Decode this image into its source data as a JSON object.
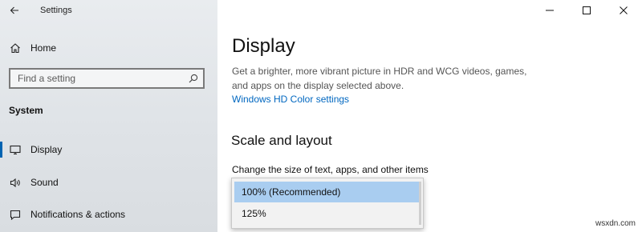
{
  "app": {
    "title": "Settings",
    "home_label": "Home"
  },
  "search": {
    "placeholder": "Find a setting"
  },
  "sidebar": {
    "section_title": "System",
    "items": [
      {
        "label": "Display",
        "icon": "monitor-icon",
        "selected": true
      },
      {
        "label": "Sound",
        "icon": "speaker-icon",
        "selected": false
      },
      {
        "label": "Notifications & actions",
        "icon": "notifications-icon",
        "selected": false
      }
    ]
  },
  "window_controls": [
    "minimize",
    "maximize",
    "close"
  ],
  "main": {
    "title": "Display",
    "description": "Get a brighter, more vibrant picture in HDR and WCG videos, games, and apps on the display selected above.",
    "link": "Windows HD Color settings",
    "scale_title": "Scale and layout",
    "scale_label": "Change the size of text, apps, and other items",
    "scale_options": [
      "100% (Recommended)",
      "125%"
    ],
    "scale_highlighted": "100% (Recommended)"
  },
  "watermark": "wsxdn.com",
  "colors": {
    "accent": "#0063b1",
    "link": "#0067c0",
    "highlight": "#a9cdf0",
    "sidebar_bg": "#e3e6ea"
  }
}
